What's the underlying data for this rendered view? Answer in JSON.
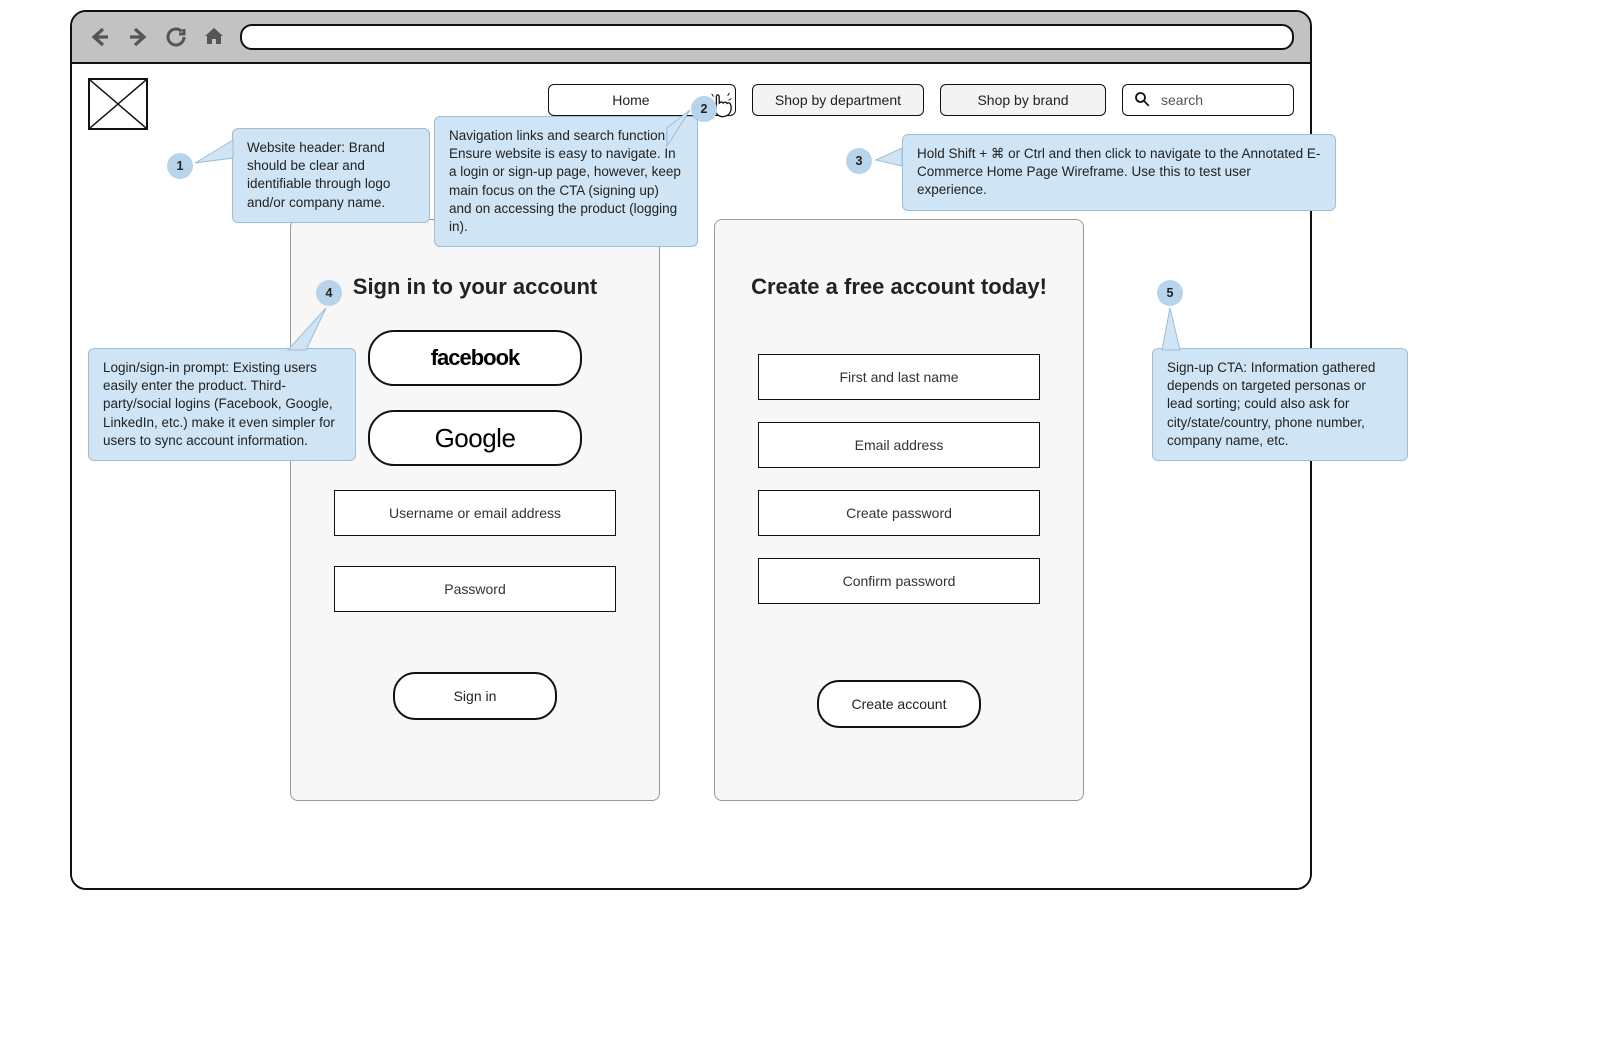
{
  "nav": {
    "home": "Home",
    "dept": "Shop by department",
    "brand": "Shop by brand",
    "search_placeholder": "search"
  },
  "signin": {
    "title": "Sign in to your account",
    "facebook": "facebook",
    "google": "Google",
    "username": "Username or email address",
    "password": "Password",
    "button": "Sign in"
  },
  "signup": {
    "title": "Create a free account today!",
    "name": "First and last name",
    "email": "Email address",
    "password": "Create password",
    "confirm": "Confirm password",
    "button": "Create account"
  },
  "annotations": {
    "n1": {
      "num": "1",
      "text": "Website header: Brand should be clear and identifiable through logo and/or company name."
    },
    "n2": {
      "num": "2",
      "text": "Navigation links and search function: Ensure website is easy to navigate. In a login or sign-up page, however, keep main focus on the CTA (signing up) and on accessing the product (logging in)."
    },
    "n3": {
      "num": "3",
      "text": "Hold Shift + ⌘ or Ctrl and then click to navigate to the Annotated E-Commerce Home Page Wireframe. Use this to test user experience."
    },
    "n4": {
      "num": "4",
      "text": "Login/sign-in prompt: Existing users easily enter the product. Third-party/social logins (Facebook, Google, LinkedIn, etc.) make it even simpler for users to sync account information."
    },
    "n5": {
      "num": "5",
      "text": "Sign-up CTA: Information gathered depends on targeted personas or lead sorting; could also ask for city/state/country, phone number, company name, etc."
    }
  }
}
